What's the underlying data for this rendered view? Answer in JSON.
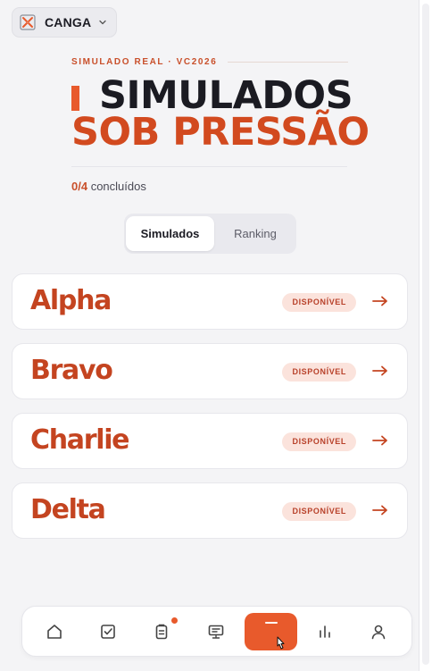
{
  "workspace": {
    "name": "CANGA"
  },
  "header": {
    "eyebrow": "SIMULADO REAL · VC2026",
    "title_line1": "SIMULADOS",
    "title_line2": "SOB PRESSÃO"
  },
  "progress": {
    "count": "0/4",
    "label": "concluídos"
  },
  "tabs": [
    {
      "label": "Simulados",
      "active": true
    },
    {
      "label": "Ranking",
      "active": false
    }
  ],
  "simulados": [
    {
      "name": "Alpha",
      "status": "DISPONÍVEL"
    },
    {
      "name": "Bravo",
      "status": "DISPONÍVEL"
    },
    {
      "name": "Charlie",
      "status": "DISPONÍVEL"
    },
    {
      "name": "Delta",
      "status": "DISPONÍVEL"
    }
  ],
  "nav": {
    "items": [
      "home-icon",
      "checkbox-icon",
      "clipboard-icon",
      "monitor-icon",
      "center-action",
      "bar-chart-icon",
      "user-icon"
    ],
    "notification_on": "clipboard-icon"
  },
  "colors": {
    "accent": "#e85a2c",
    "title_orange": "#d24a1f",
    "badge_bg": "#fbe3dc",
    "dark": "#1b1b22"
  }
}
